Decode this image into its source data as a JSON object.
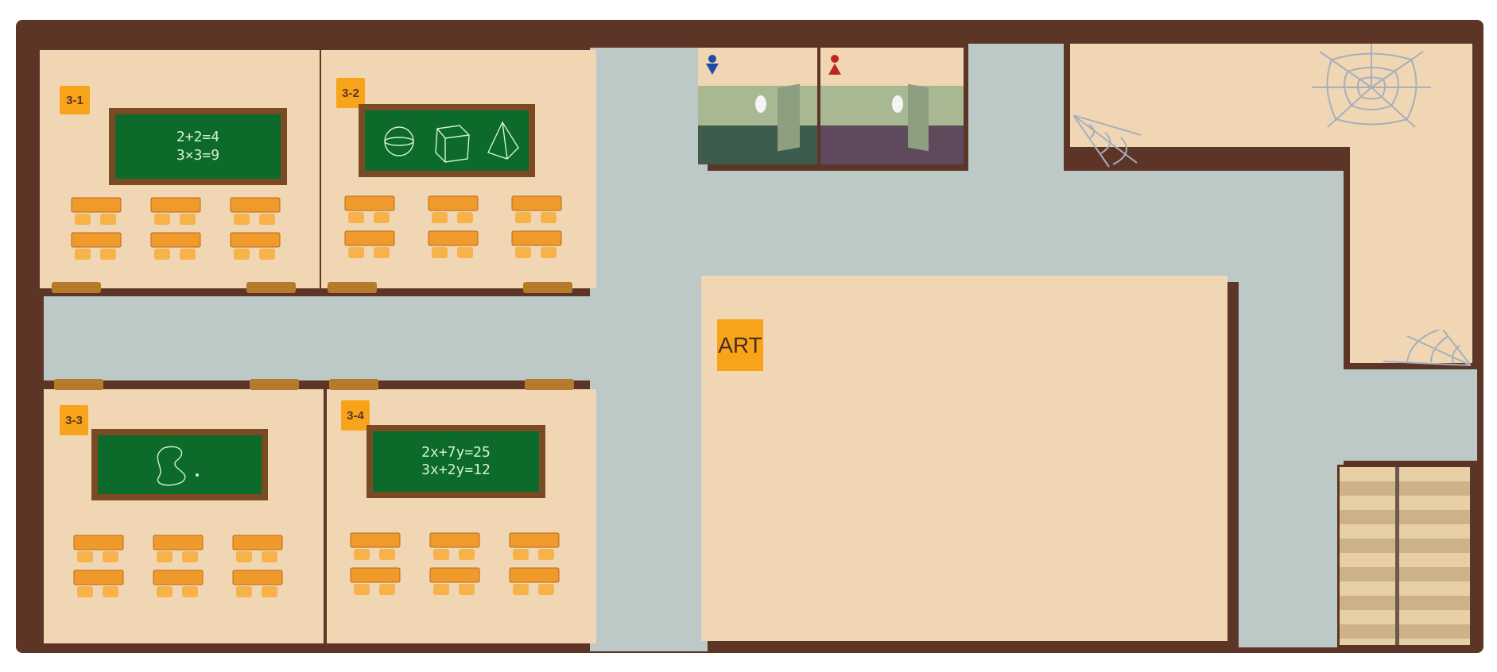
{
  "rooms": {
    "r31": {
      "label": "3-1",
      "board_lines": [
        "2+2=4",
        "3×3=9"
      ]
    },
    "r32": {
      "label": "3-2"
    },
    "r33": {
      "label": "3-3"
    },
    "r34": {
      "label": "3-4",
      "board_lines": [
        "2x+7y=25",
        "3x+2y=12"
      ]
    },
    "art": {
      "label": "ART"
    }
  },
  "restrooms": {
    "mens": {
      "icon": "male-restroom-icon",
      "color": "#1c4ea8"
    },
    "womens": {
      "icon": "female-restroom-icon",
      "color": "#c0261e"
    }
  },
  "colors": {
    "wall": "#5c3527",
    "floor": "#f1d6b4",
    "corridor": "#bcc9c6",
    "badge": "#f8a41a",
    "chalkboard": "#0c6b2a",
    "desk": "#ef9a2b"
  }
}
